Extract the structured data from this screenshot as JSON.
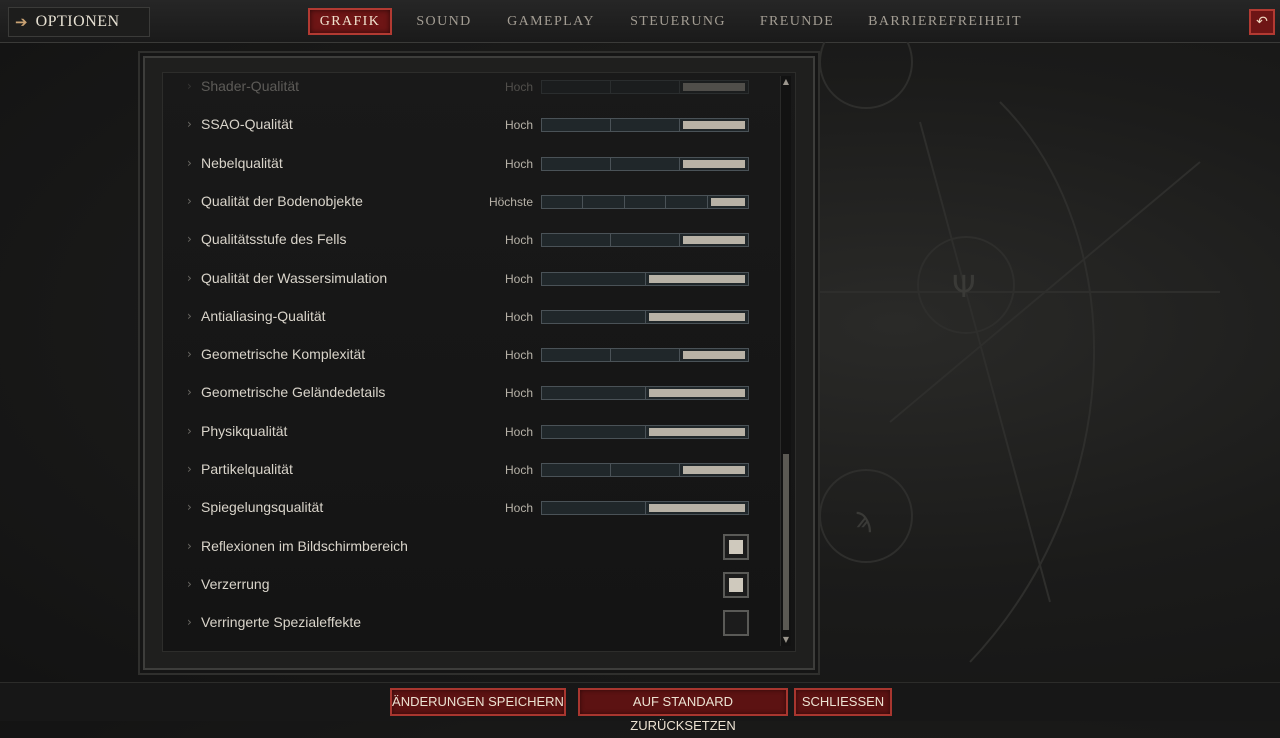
{
  "header": {
    "title": "OPTIONEN",
    "title_icon": "arrow-right-icon",
    "back_icon": "undo-icon",
    "tabs": [
      {
        "label": "GRAFIK",
        "active": true
      },
      {
        "label": "SOUND",
        "active": false
      },
      {
        "label": "GAMEPLAY",
        "active": false
      },
      {
        "label": "STEUERUNG",
        "active": false
      },
      {
        "label": "FREUNDE",
        "active": false
      },
      {
        "label": "BARRIEREFREIHEIT",
        "active": false
      }
    ]
  },
  "settings": {
    "rows": [
      {
        "label": "Shader-Qualität",
        "value": "Hoch",
        "kind": "slider",
        "segments": 3,
        "filled": 3
      },
      {
        "label": "SSAO-Qualität",
        "value": "Hoch",
        "kind": "slider",
        "segments": 3,
        "filled": 3
      },
      {
        "label": "Nebelqualität",
        "value": "Hoch",
        "kind": "slider",
        "segments": 3,
        "filled": 3
      },
      {
        "label": "Qualität der Bodenobjekte",
        "value": "Höchste",
        "kind": "slider",
        "segments": 5,
        "filled": 5
      },
      {
        "label": "Qualitätsstufe des Fells",
        "value": "Hoch",
        "kind": "slider",
        "segments": 3,
        "filled": 3
      },
      {
        "label": "Qualität der Wassersimulation",
        "value": "Hoch",
        "kind": "slider",
        "segments": 2,
        "filled": 2
      },
      {
        "label": "Antialiasing-Qualität",
        "value": "Hoch",
        "kind": "slider",
        "segments": 2,
        "filled": 2
      },
      {
        "label": "Geometrische Komplexität",
        "value": "Hoch",
        "kind": "slider",
        "segments": 3,
        "filled": 3
      },
      {
        "label": "Geometrische Geländedetails",
        "value": "Hoch",
        "kind": "slider",
        "segments": 2,
        "filled": 2
      },
      {
        "label": "Physikqualität",
        "value": "Hoch",
        "kind": "slider",
        "segments": 2,
        "filled": 2
      },
      {
        "label": "Partikelqualität",
        "value": "Hoch",
        "kind": "slider",
        "segments": 3,
        "filled": 3
      },
      {
        "label": "Spiegelungsqualität",
        "value": "Hoch",
        "kind": "slider",
        "segments": 2,
        "filled": 2
      },
      {
        "label": "Reflexionen im Bildschirmbereich",
        "kind": "checkbox",
        "checked": true
      },
      {
        "label": "Verzerrung",
        "kind": "checkbox",
        "checked": true
      },
      {
        "label": "Verringerte Spezialeffekte",
        "kind": "checkbox",
        "checked": false
      }
    ]
  },
  "footer": {
    "save_label": "ÄNDERUNGEN SPEICHERN",
    "reset_label": "AUF STANDARD ZURÜCKSETZEN",
    "close_label": "SCHLIESSEN"
  },
  "colors": {
    "accent_red": "#6e1515",
    "accent_border": "#b23a32",
    "slider_fill": "#b8b2a6"
  }
}
